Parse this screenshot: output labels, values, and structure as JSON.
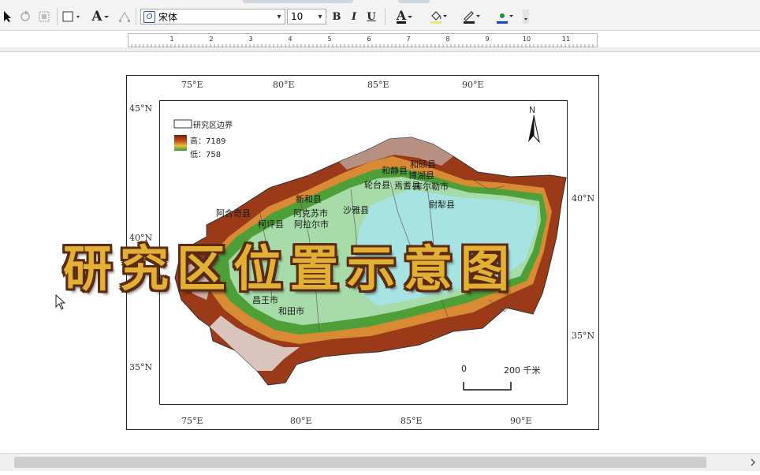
{
  "toolbar": {
    "font_name": "宋体",
    "font_size": "10",
    "bold_label": "B",
    "italic_label": "I",
    "underline_label": "U",
    "font_color_label": "A",
    "text_tool_label": "A"
  },
  "ruler": {
    "labels": [
      "1",
      "2",
      "3",
      "4",
      "5",
      "6",
      "7",
      "8",
      "9",
      "10",
      "11"
    ]
  },
  "map": {
    "legend": {
      "boundary_label": "研究区边界",
      "high_label": "高：7189",
      "low_label": "低：758"
    },
    "north_label": "N",
    "scale": {
      "zero_label": "0",
      "dist_label": "200 千米"
    },
    "top_lon_labels": [
      "75°E",
      "80°E",
      "85°E",
      "90°E"
    ],
    "bottom_lon_labels": [
      "75°E",
      "80°E",
      "85°E",
      "90°E"
    ],
    "left_lat_labels": [
      "45°N",
      "40°N",
      "35°N"
    ],
    "right_lat_labels": [
      "40°N",
      "35°N"
    ],
    "counties": [
      "和硕县",
      "博湖县",
      "和静县",
      "焉耆县",
      "库尔勒市",
      "尉犁县",
      "新和县",
      "阿克苏市",
      "阿拉尔市",
      "柯坪县",
      "阿合奇县",
      "昌王市",
      "和田市",
      "沙雅县",
      "轮台县"
    ]
  },
  "overlay_title": "研究区位置示意图"
}
